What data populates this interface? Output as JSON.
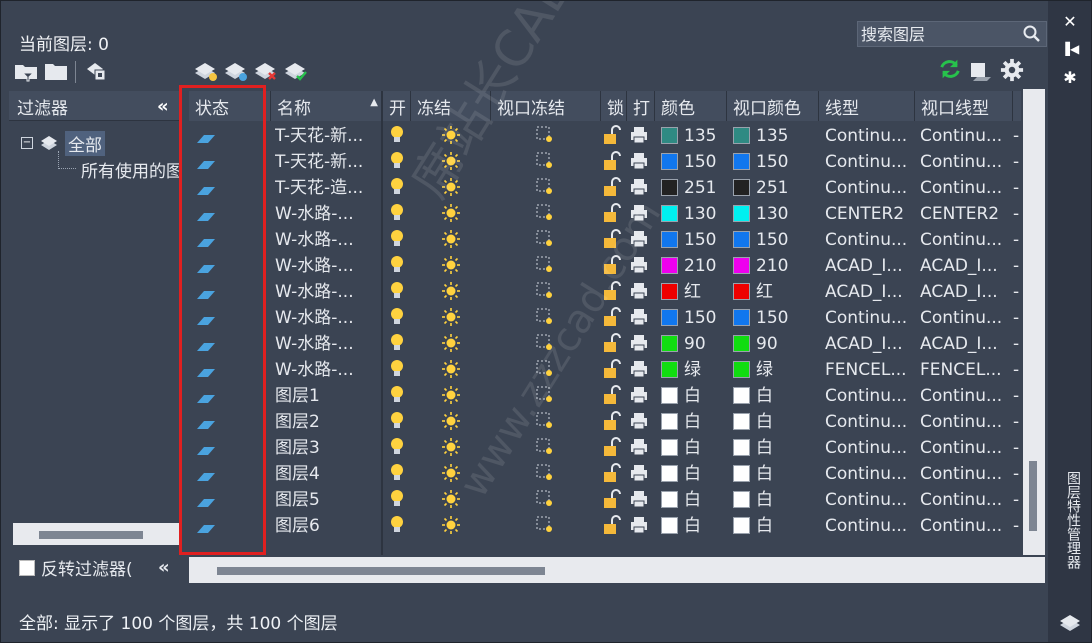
{
  "current_layer": "当前图层: 0",
  "search": {
    "placeholder": "搜索图层"
  },
  "palette_title": "图层特性管理器",
  "filters": {
    "header": "过滤器",
    "root": "全部",
    "child": "所有使用的图层",
    "invert_label": "反转过滤器("
  },
  "columns": {
    "status": "状态",
    "name": "名称",
    "on": "开",
    "freeze": "冻结",
    "vp_freeze": "视口冻结",
    "lock": "锁",
    "plot": "打",
    "color": "颜色",
    "vp_color": "视口颜色",
    "linetype": "线型",
    "vp_linetype": "视口线型"
  },
  "rows": [
    {
      "name": "T-天花-新...",
      "color": "135",
      "color_hex": "#2f8a83",
      "vp_color": "135",
      "linetype": "Continu...",
      "vp_linetype": "Continu..."
    },
    {
      "name": "T-天花-新...",
      "color": "150",
      "color_hex": "#1177ee",
      "vp_color": "150",
      "linetype": "Continu...",
      "vp_linetype": "Continu..."
    },
    {
      "name": "T-天花-造...",
      "color": "251",
      "color_hex": "#222222",
      "vp_color": "251",
      "linetype": "Continu...",
      "vp_linetype": "Continu..."
    },
    {
      "name": "W-水路-...",
      "color": "130",
      "color_hex": "#00f0f0",
      "vp_color": "130",
      "linetype": "CENTER2",
      "vp_linetype": "CENTER2"
    },
    {
      "name": "W-水路-...",
      "color": "150",
      "color_hex": "#1177ee",
      "vp_color": "150",
      "linetype": "Continu...",
      "vp_linetype": "Continu..."
    },
    {
      "name": "W-水路-...",
      "color": "210",
      "color_hex": "#ee00ee",
      "vp_color": "210",
      "linetype": "ACAD_I...",
      "vp_linetype": "ACAD_I..."
    },
    {
      "name": "W-水路-...",
      "color": "红",
      "color_hex": "#ee0000",
      "vp_color": "红",
      "linetype": "ACAD_I...",
      "vp_linetype": "ACAD_I..."
    },
    {
      "name": "W-水路-...",
      "color": "150",
      "color_hex": "#1177ee",
      "vp_color": "150",
      "linetype": "Continu...",
      "vp_linetype": "Continu..."
    },
    {
      "name": "W-水路-...",
      "color": "90",
      "color_hex": "#11dd11",
      "vp_color": "90",
      "linetype": "ACAD_I...",
      "vp_linetype": "ACAD_I..."
    },
    {
      "name": "W-水路-...",
      "color": "绿",
      "color_hex": "#11dd11",
      "vp_color": "绿",
      "linetype": "FENCEL...",
      "vp_linetype": "FENCEL..."
    },
    {
      "name": "图层1",
      "color": "白",
      "color_hex": "#ffffff",
      "vp_color": "白",
      "linetype": "Continu...",
      "vp_linetype": "Continu..."
    },
    {
      "name": "图层2",
      "color": "白",
      "color_hex": "#ffffff",
      "vp_color": "白",
      "linetype": "Continu...",
      "vp_linetype": "Continu..."
    },
    {
      "name": "图层3",
      "color": "白",
      "color_hex": "#ffffff",
      "vp_color": "白",
      "linetype": "Continu...",
      "vp_linetype": "Continu..."
    },
    {
      "name": "图层4",
      "color": "白",
      "color_hex": "#ffffff",
      "vp_color": "白",
      "linetype": "Continu...",
      "vp_linetype": "Continu..."
    },
    {
      "name": "图层5",
      "color": "白",
      "color_hex": "#ffffff",
      "vp_color": "白",
      "linetype": "Continu...",
      "vp_linetype": "Continu..."
    },
    {
      "name": "图层6",
      "color": "白",
      "color_hex": "#ffffff",
      "vp_color": "白",
      "linetype": "Continu...",
      "vp_linetype": "Continu..."
    }
  ],
  "watermark": "席站长CAD",
  "watermark_url": "www.zzzcad.com",
  "status_text": "全部: 显示了 100 个图层，共 100 个图层",
  "colors": {
    "panel": "#3b4453",
    "header": "#434d5e",
    "highlight": "#e02020",
    "refresh": "#27c24c"
  }
}
